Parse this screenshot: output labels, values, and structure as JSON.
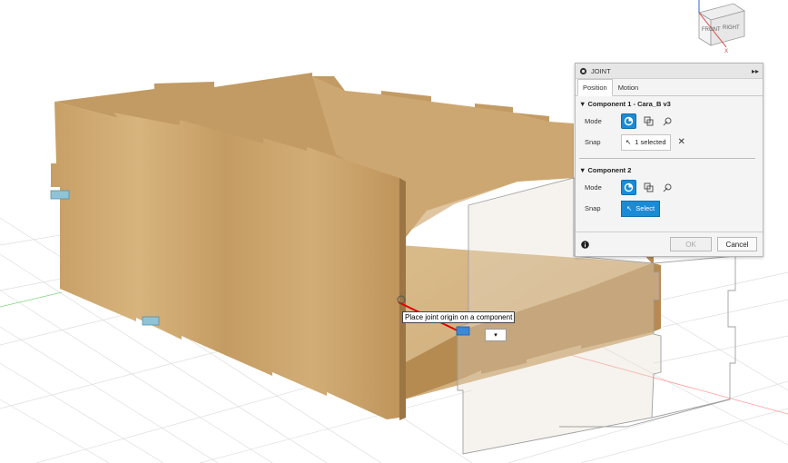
{
  "viewcube": {
    "front_label": "FRONT",
    "right_label": "RIGHT",
    "axis_label": "X"
  },
  "panel": {
    "title": "JOINT",
    "expand_glyph": "▸▸",
    "tabs": [
      {
        "label": "Position"
      },
      {
        "label": "Motion"
      }
    ],
    "component1": {
      "title": "Component 1 - Cara_B v3",
      "mode_label": "Mode",
      "snap_label": "Snap",
      "snap_value": "1 selected",
      "clear_glyph": "✕"
    },
    "component2": {
      "title": "Component 2",
      "mode_label": "Mode",
      "snap_label": "Snap",
      "snap_button": "Select"
    },
    "ok_label": "OK",
    "cancel_label": "Cancel"
  },
  "tooltip": {
    "text": "Place joint origin on a component"
  },
  "colors": {
    "accent": "#1a8bd6",
    "wood": "#c9a46d",
    "joint_line": "#e00000"
  }
}
